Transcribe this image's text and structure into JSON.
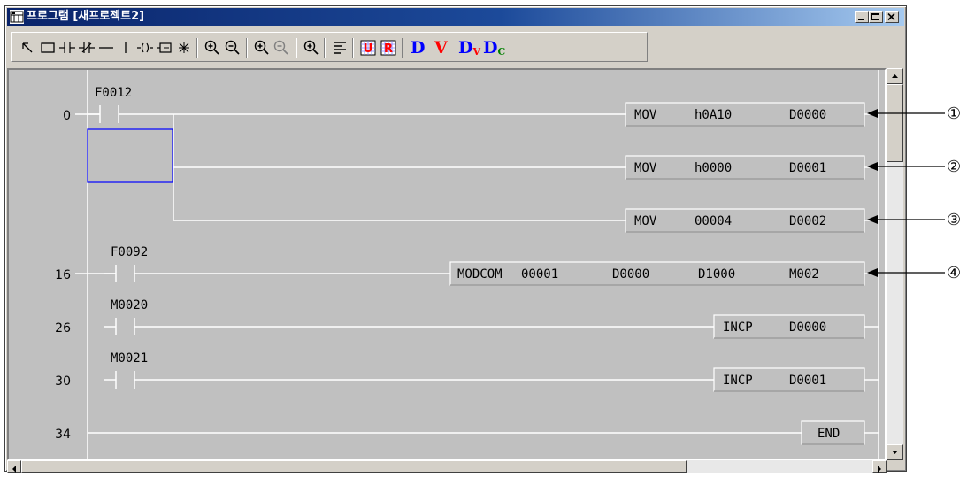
{
  "window": {
    "title": "프로그램 [새프로젝트2]",
    "controls": [
      "_",
      "□",
      "×"
    ]
  },
  "toolbar": {
    "tools": [
      "select-arrow-icon",
      "box-cursor-icon",
      "no-contact-icon",
      "nc-contact-icon",
      "horizontal-line-icon",
      "vertical-line-icon",
      "coil-icon",
      "function-box-icon",
      "ruler-icon",
      "zoom-in-icon",
      "zoom-out-icon",
      "zoom-in-all-icon",
      "zoom-out-all-icon",
      "zoom-fit-icon",
      "text-align-icon",
      "u-icon",
      "r-icon"
    ],
    "letters": [
      "D",
      "V",
      "D",
      "V",
      "D",
      "C"
    ],
    "letter_colors": {
      "blue": "#0000ff",
      "red": "#ff0000"
    }
  },
  "ladder": {
    "rungs": [
      {
        "step": "0",
        "contact": "F0012",
        "instructions": [
          {
            "op": "MOV",
            "a": "h0A10",
            "b": "D0000",
            "callout": "①"
          },
          {
            "op": "MOV",
            "a": "h0000",
            "b": "D0001",
            "callout": "②"
          },
          {
            "op": "MOV",
            "a": "00004",
            "b": "D0002",
            "callout": "③"
          }
        ]
      },
      {
        "step": "16",
        "contact": "F0092",
        "instructions": [
          {
            "op": "MODCOM",
            "a": "00001",
            "b": "D0000",
            "c": "D1000",
            "d": "M002",
            "callout": "④"
          }
        ]
      },
      {
        "step": "26",
        "contact": "M0020",
        "instructions": [
          {
            "op": "INCP",
            "a": "D0000"
          }
        ]
      },
      {
        "step": "30",
        "contact": "M0021",
        "instructions": [
          {
            "op": "INCP",
            "a": "D0001"
          }
        ]
      },
      {
        "step": "34",
        "contact": "",
        "instructions": [
          {
            "op": "END"
          }
        ]
      }
    ]
  },
  "colors": {
    "canvas": "#c0c0c0",
    "rail": "#ffffff",
    "cursor": "#0000ff",
    "title_start": "#0a246a",
    "title_end": "#a6caf0"
  }
}
